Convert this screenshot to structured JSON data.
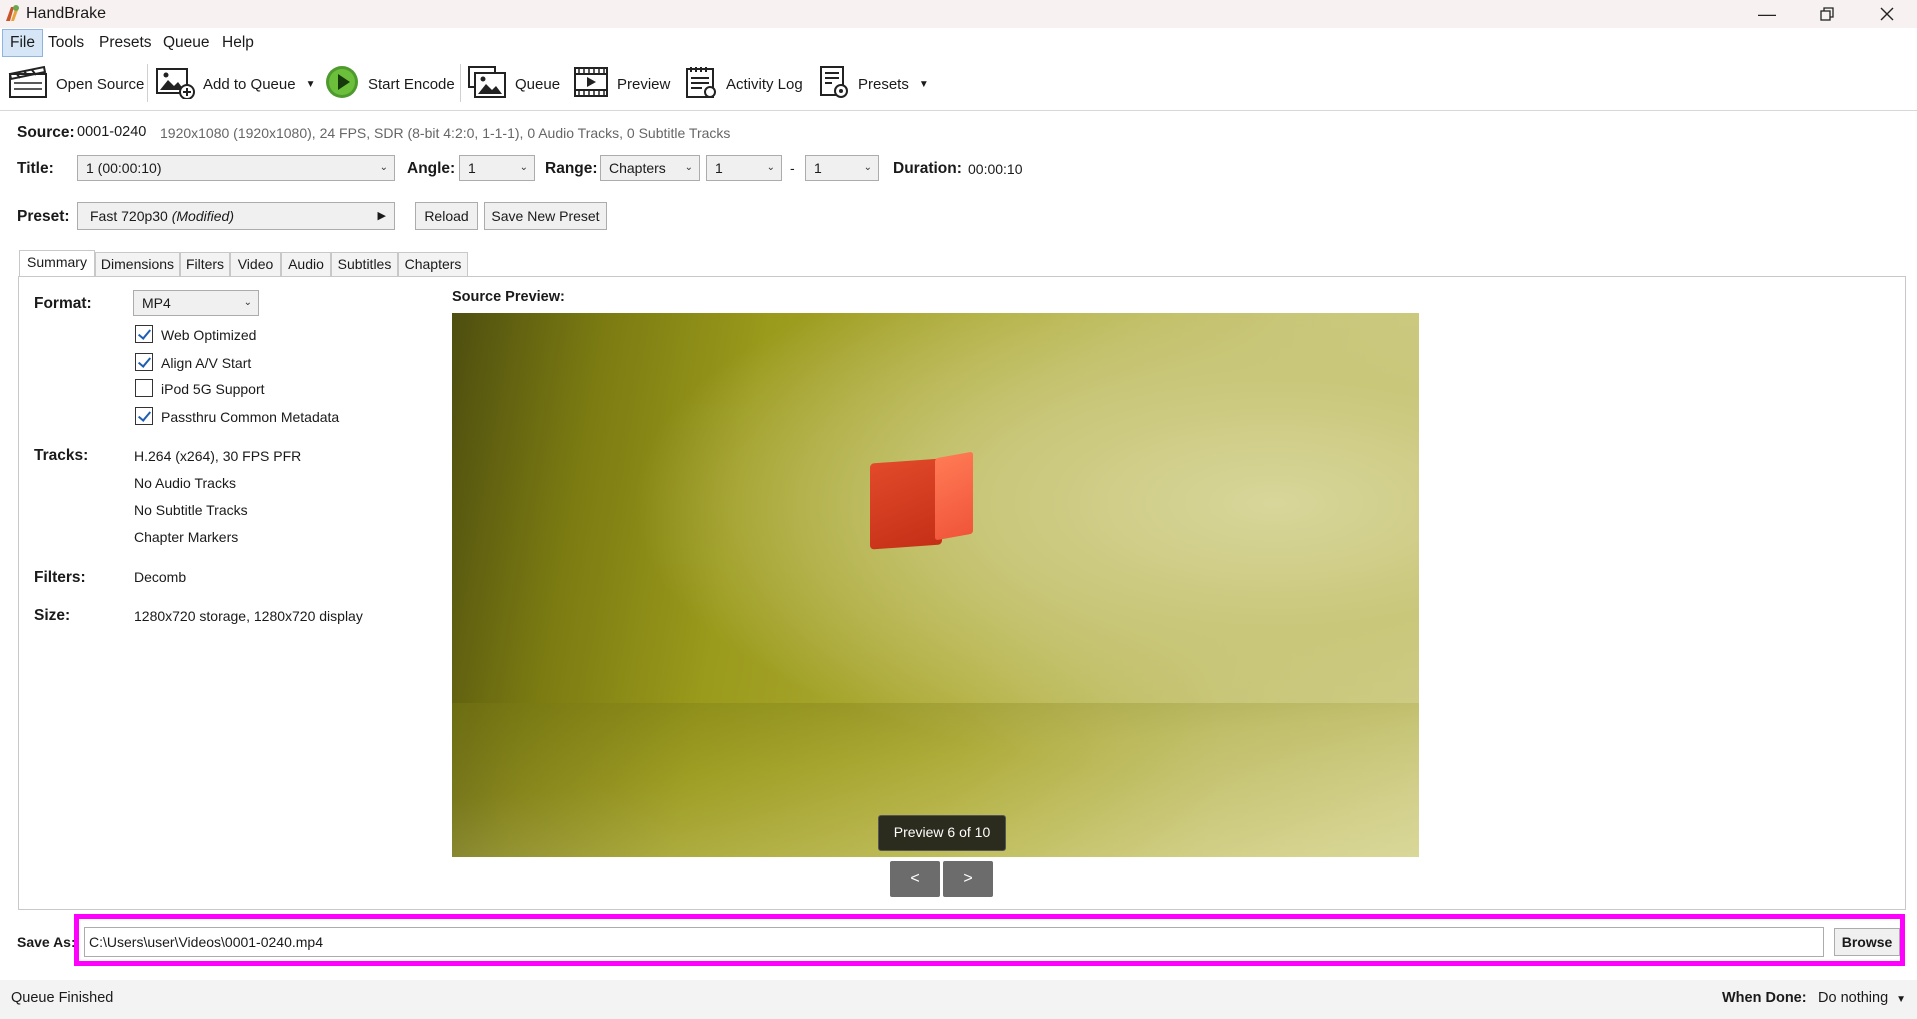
{
  "window": {
    "title": "HandBrake"
  },
  "menu": {
    "file": "File",
    "tools": "Tools",
    "presets": "Presets",
    "queue": "Queue",
    "help": "Help"
  },
  "toolbar": {
    "open_source": "Open Source",
    "add_to_queue": "Add to Queue",
    "start_encode": "Start Encode",
    "queue": "Queue",
    "preview": "Preview",
    "activity_log": "Activity Log",
    "presets": "Presets"
  },
  "source": {
    "label": "Source:",
    "name": "0001-0240",
    "info": "1920x1080 (1920x1080), 24 FPS, SDR (8-bit 4:2:0, 1-1-1), 0 Audio Tracks, 0 Subtitle Tracks"
  },
  "title_row": {
    "title_label": "Title:",
    "title_value": "1  (00:00:10)",
    "angle_label": "Angle:",
    "angle_value": "1",
    "range_label": "Range:",
    "range_type": "Chapters",
    "range_start": "1",
    "range_dash": "-",
    "range_end": "1",
    "duration_label": "Duration:",
    "duration_value": "00:00:10"
  },
  "preset_row": {
    "label": "Preset:",
    "name": "Fast 720p30",
    "modified": "(Modified)",
    "reload": "Reload",
    "save_new": "Save New Preset"
  },
  "tabs": [
    "Summary",
    "Dimensions",
    "Filters",
    "Video",
    "Audio",
    "Subtitles",
    "Chapters"
  ],
  "summary": {
    "format_label": "Format:",
    "format_value": "MP4",
    "options": [
      {
        "label": "Web Optimized",
        "checked": true
      },
      {
        "label": "Align A/V Start",
        "checked": true
      },
      {
        "label": "iPod 5G Support",
        "checked": false
      },
      {
        "label": "Passthru Common Metadata",
        "checked": true
      }
    ],
    "tracks_label": "Tracks:",
    "tracks": [
      "H.264 (x264), 30 FPS PFR",
      "No Audio Tracks",
      "No Subtitle Tracks",
      "Chapter Markers"
    ],
    "filters_label": "Filters:",
    "filters_value": "Decomb",
    "size_label": "Size:",
    "size_value": "1280x720 storage, 1280x720 display"
  },
  "preview": {
    "label": "Source Preview:",
    "badge": "Preview 6 of 10",
    "prev": "<",
    "next": ">"
  },
  "save_as": {
    "label": "Save As:",
    "path": "C:\\Users\\user\\Videos\\0001-0240.mp4",
    "browse": "Browse"
  },
  "status": {
    "text": "Queue Finished",
    "when_done_label": "When Done:",
    "when_done_value": "Do nothing"
  }
}
